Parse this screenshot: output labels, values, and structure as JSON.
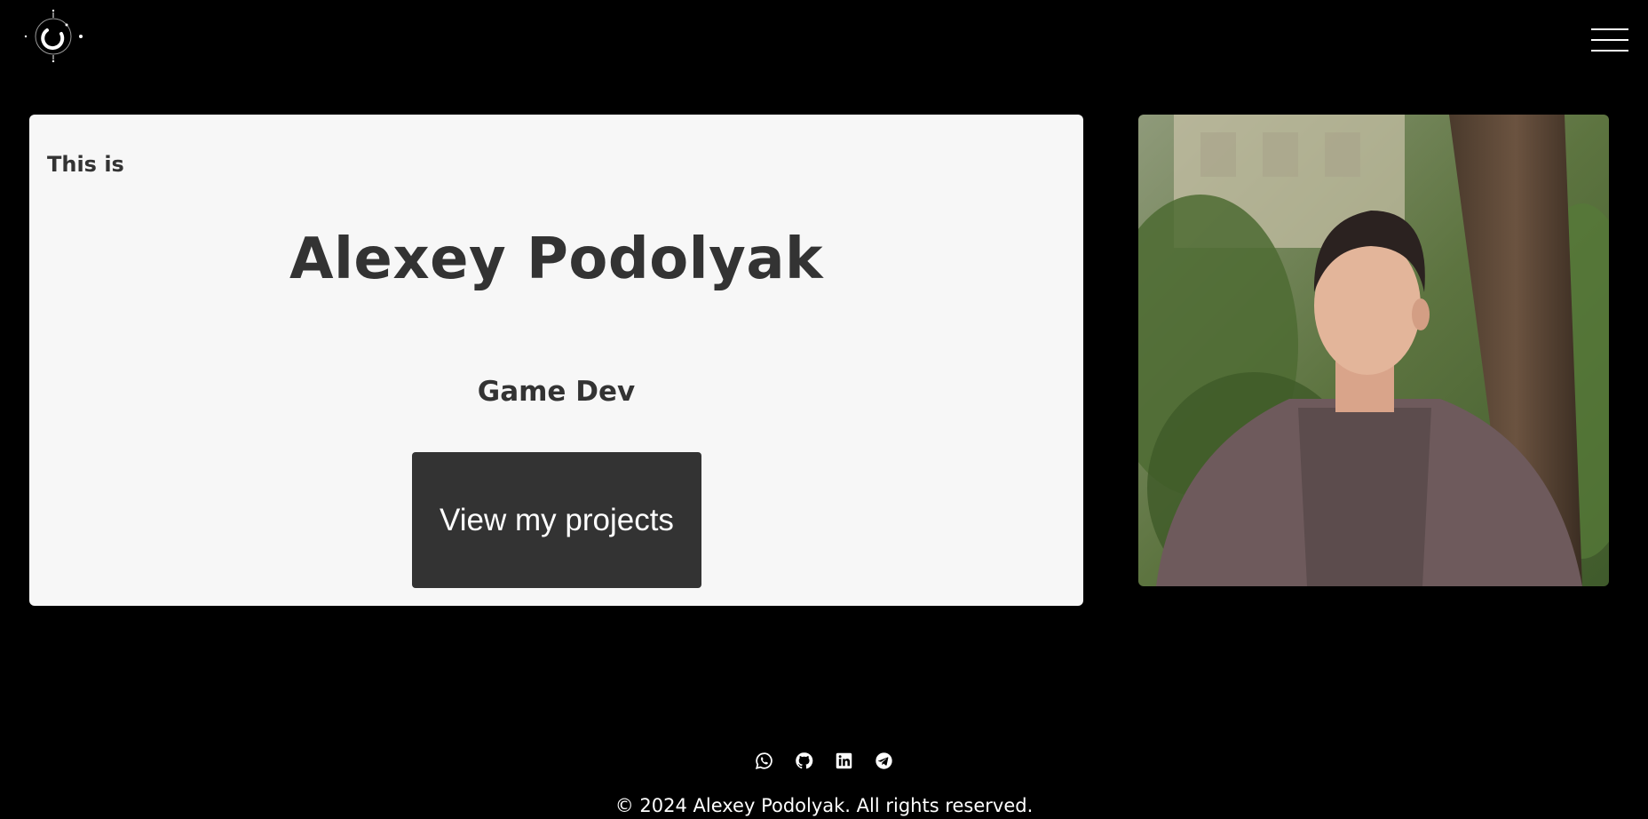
{
  "header": {
    "logo_icon": "spiral-moon-logo-icon",
    "menu_icon": "hamburger-menu-icon"
  },
  "hero": {
    "intro": "This is",
    "name": "Alexey Podolyak",
    "role": "Game Dev",
    "cta_label": "View my projects"
  },
  "photo": {
    "alt": "Alexey Podolyak"
  },
  "footer": {
    "socials": [
      {
        "icon": "whatsapp-icon"
      },
      {
        "icon": "github-icon"
      },
      {
        "icon": "linkedin-icon"
      },
      {
        "icon": "telegram-icon"
      }
    ],
    "copyright": "© 2024 Alexey Podolyak. All rights reserved."
  },
  "colors": {
    "background": "#000000",
    "card": "#f7f7f7",
    "text": "#333333",
    "button": "#333333",
    "button_text": "#ffffff"
  }
}
